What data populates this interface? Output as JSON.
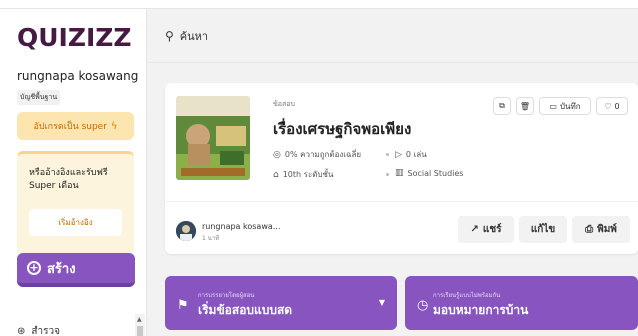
{
  "brand": {
    "logo": "QUIZIZZ",
    "color": "#461a42",
    "accent": "#8854c0"
  },
  "sidebar": {
    "username": "rungnapa kosawang",
    "plan": "บัญชีพื้นฐาน",
    "upgrade_label": "อัปเกรดเป็น super",
    "referral_text": "หรืออ้างอิงและรับฟรี Super เดือน",
    "referral_button": "เริ่มอ้างอิง",
    "create_label": "สร้าง",
    "nav_item": "สำรวจ"
  },
  "search": {
    "placeholder": "ค้นหา"
  },
  "quiz": {
    "type": "ข้อสอบ",
    "title": "เรื่องเศรษฐกิจพอเพียง",
    "accuracy": "0% ความถูกต้องเฉลี่ย",
    "plays": "0 เล่น",
    "grade": "10th ระดับชั้น",
    "subject": "Social Studies",
    "save_label": "บันทึก",
    "likes": "0",
    "author": "rungnapa kosawa...",
    "time": "1 นาที",
    "share_label": "แชร์",
    "edit_label": "แก้ไข",
    "print_label": "พิมพ์"
  },
  "actions": {
    "live": {
      "small": "การบรรยายโดยผู้สอน",
      "big": "เริ่มข้อสอบแบบสด"
    },
    "homework": {
      "small": "การเรียนรู้แบบไม่พร้อมกัน",
      "big": "มอบหมายการบ้าน"
    }
  }
}
